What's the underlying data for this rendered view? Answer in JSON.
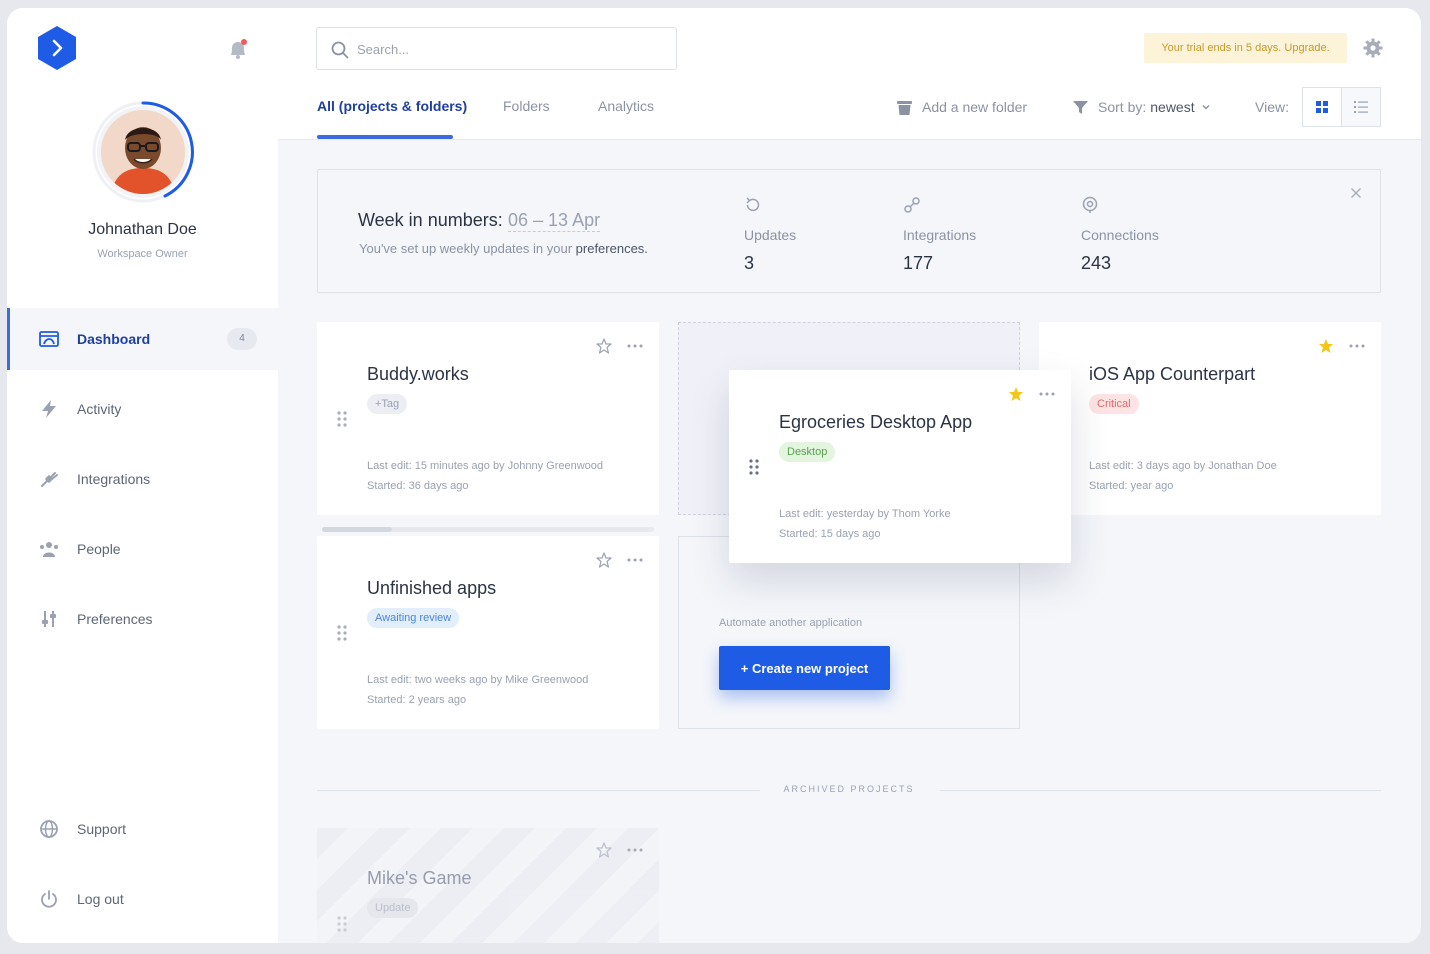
{
  "user": {
    "name": "Johnathan Doe",
    "role": "Workspace Owner"
  },
  "nav": {
    "items": [
      {
        "label": "Dashboard",
        "badge": "4",
        "icon": "dashboard-icon",
        "active": true
      },
      {
        "label": "Activity",
        "icon": "bolt-icon"
      },
      {
        "label": "Integrations",
        "icon": "plug-icon"
      },
      {
        "label": "People",
        "icon": "people-icon"
      },
      {
        "label": "Preferences",
        "icon": "sliders-icon"
      }
    ],
    "bottom": [
      {
        "label": "Support",
        "icon": "globe-icon"
      },
      {
        "label": "Log out",
        "icon": "power-icon"
      }
    ]
  },
  "search": {
    "placeholder": "Search..."
  },
  "trial_banner": "Your trial ends in 5 days. Upgrade.",
  "tabs": [
    {
      "label": "All (projects & folders)",
      "active": true
    },
    {
      "label": "Folders"
    },
    {
      "label": "Analytics"
    }
  ],
  "toolbar": {
    "add_folder": "Add a new folder",
    "sort_prefix": "Sort by:",
    "sort_value": "newest",
    "view_label": "View:"
  },
  "week": {
    "title": "Week in numbers:",
    "range": "06 – 13 Apr",
    "subtitle_prefix": "You've set up weekly updates in your",
    "subtitle_link": "preferences.",
    "stats": [
      {
        "label": "Updates",
        "value": "3"
      },
      {
        "label": "Integrations",
        "value": "177"
      },
      {
        "label": "Connections",
        "value": "243"
      }
    ]
  },
  "projects": [
    {
      "title": "Buddy.works",
      "tag": "+Tag",
      "last_edit": "Last edit: 15 minutes ago by Johnny Greenwood",
      "started": "Started: 36 days ago",
      "starred": false
    },
    {
      "title": "Egroceries Desktop App",
      "tag": "Desktop",
      "last_edit": "Last edit: yesterday by Thom Yorke",
      "started": "Started: 15 days ago",
      "starred": true
    },
    {
      "title": "iOS App Counterpart",
      "tag": "Critical",
      "last_edit": "Last edit: 3 days ago by Jonathan Doe",
      "started": "Started: year ago",
      "starred": true
    },
    {
      "title": "Unfinished apps",
      "tag": "Awaiting review",
      "last_edit": "Last edit: two weeks ago by Mike Greenwood",
      "started": "Started: 2 years ago",
      "starred": false
    }
  ],
  "create": {
    "hint": "Automate another application",
    "button": "+ Create new project"
  },
  "archived": {
    "label": "ARCHIVED PROJECTS",
    "projects": [
      {
        "title": "Mike's Game",
        "tag": "Update"
      }
    ]
  },
  "colors": {
    "accent": "#1f5ce6",
    "nav_active": "#1f3f9f",
    "star": "#f5c518",
    "tag_desktop": "#e3f4df",
    "tag_critical": "#fde3e3",
    "tag_review": "#e2eefc",
    "trial_bg": "#fdf3d9"
  }
}
